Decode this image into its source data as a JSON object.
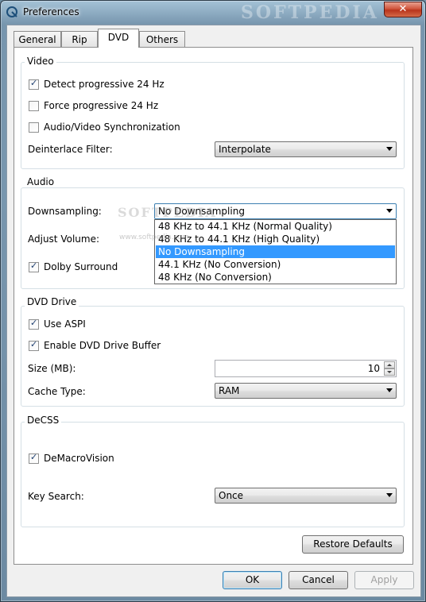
{
  "window": {
    "title": "Preferences",
    "close_label": "✕",
    "watermark": "SOFTPEDIA"
  },
  "tabs": [
    "General",
    "Rip",
    "DVD",
    "Others"
  ],
  "active_tab": "DVD",
  "video": {
    "group_label": "Video",
    "detect_progressive": {
      "label": "Detect progressive 24 Hz",
      "checked": true
    },
    "force_progressive": {
      "label": "Force progressive 24 Hz",
      "checked": false
    },
    "av_sync": {
      "label": "Audio/Video Synchronization",
      "checked": false
    },
    "deinterlace_label": "Deinterlace Filter:",
    "deinterlace_value": "Interpolate"
  },
  "audio": {
    "group_label": "Audio",
    "downsampling_label": "Downsampling:",
    "downsampling_value": "No Downsampling",
    "downsampling_options": [
      "48 KHz to 44.1 KHz (Normal Quality)",
      "48 KHz to 44.1 KHz (High Quality)",
      "No Downsampling",
      "44.1 KHz (No Conversion)",
      "48 KHz (No Conversion)"
    ],
    "adjust_volume_label": "Adjust Volume:",
    "dolby_surround": {
      "label": "Dolby Surround",
      "checked": true
    }
  },
  "dvd_drive": {
    "group_label": "DVD Drive",
    "use_aspi": {
      "label": "Use ASPI",
      "checked": true
    },
    "enable_buffer": {
      "label": "Enable DVD Drive Buffer",
      "checked": true
    },
    "size_label": "Size (MB):",
    "size_value": "10",
    "cache_type_label": "Cache Type:",
    "cache_type_value": "RAM"
  },
  "decss": {
    "group_label": "DeCSS",
    "demacrovision": {
      "label": "DeMacroVision",
      "checked": true
    },
    "key_search_label": "Key Search:",
    "key_search_value": "Once"
  },
  "buttons": {
    "restore_defaults": "Restore Defaults",
    "ok": "OK",
    "cancel": "Cancel",
    "apply": "Apply"
  },
  "overlay_watermark": {
    "large": "SOFTPEDIA",
    "small": "www.softpedia.com"
  },
  "check_mark": "✓"
}
